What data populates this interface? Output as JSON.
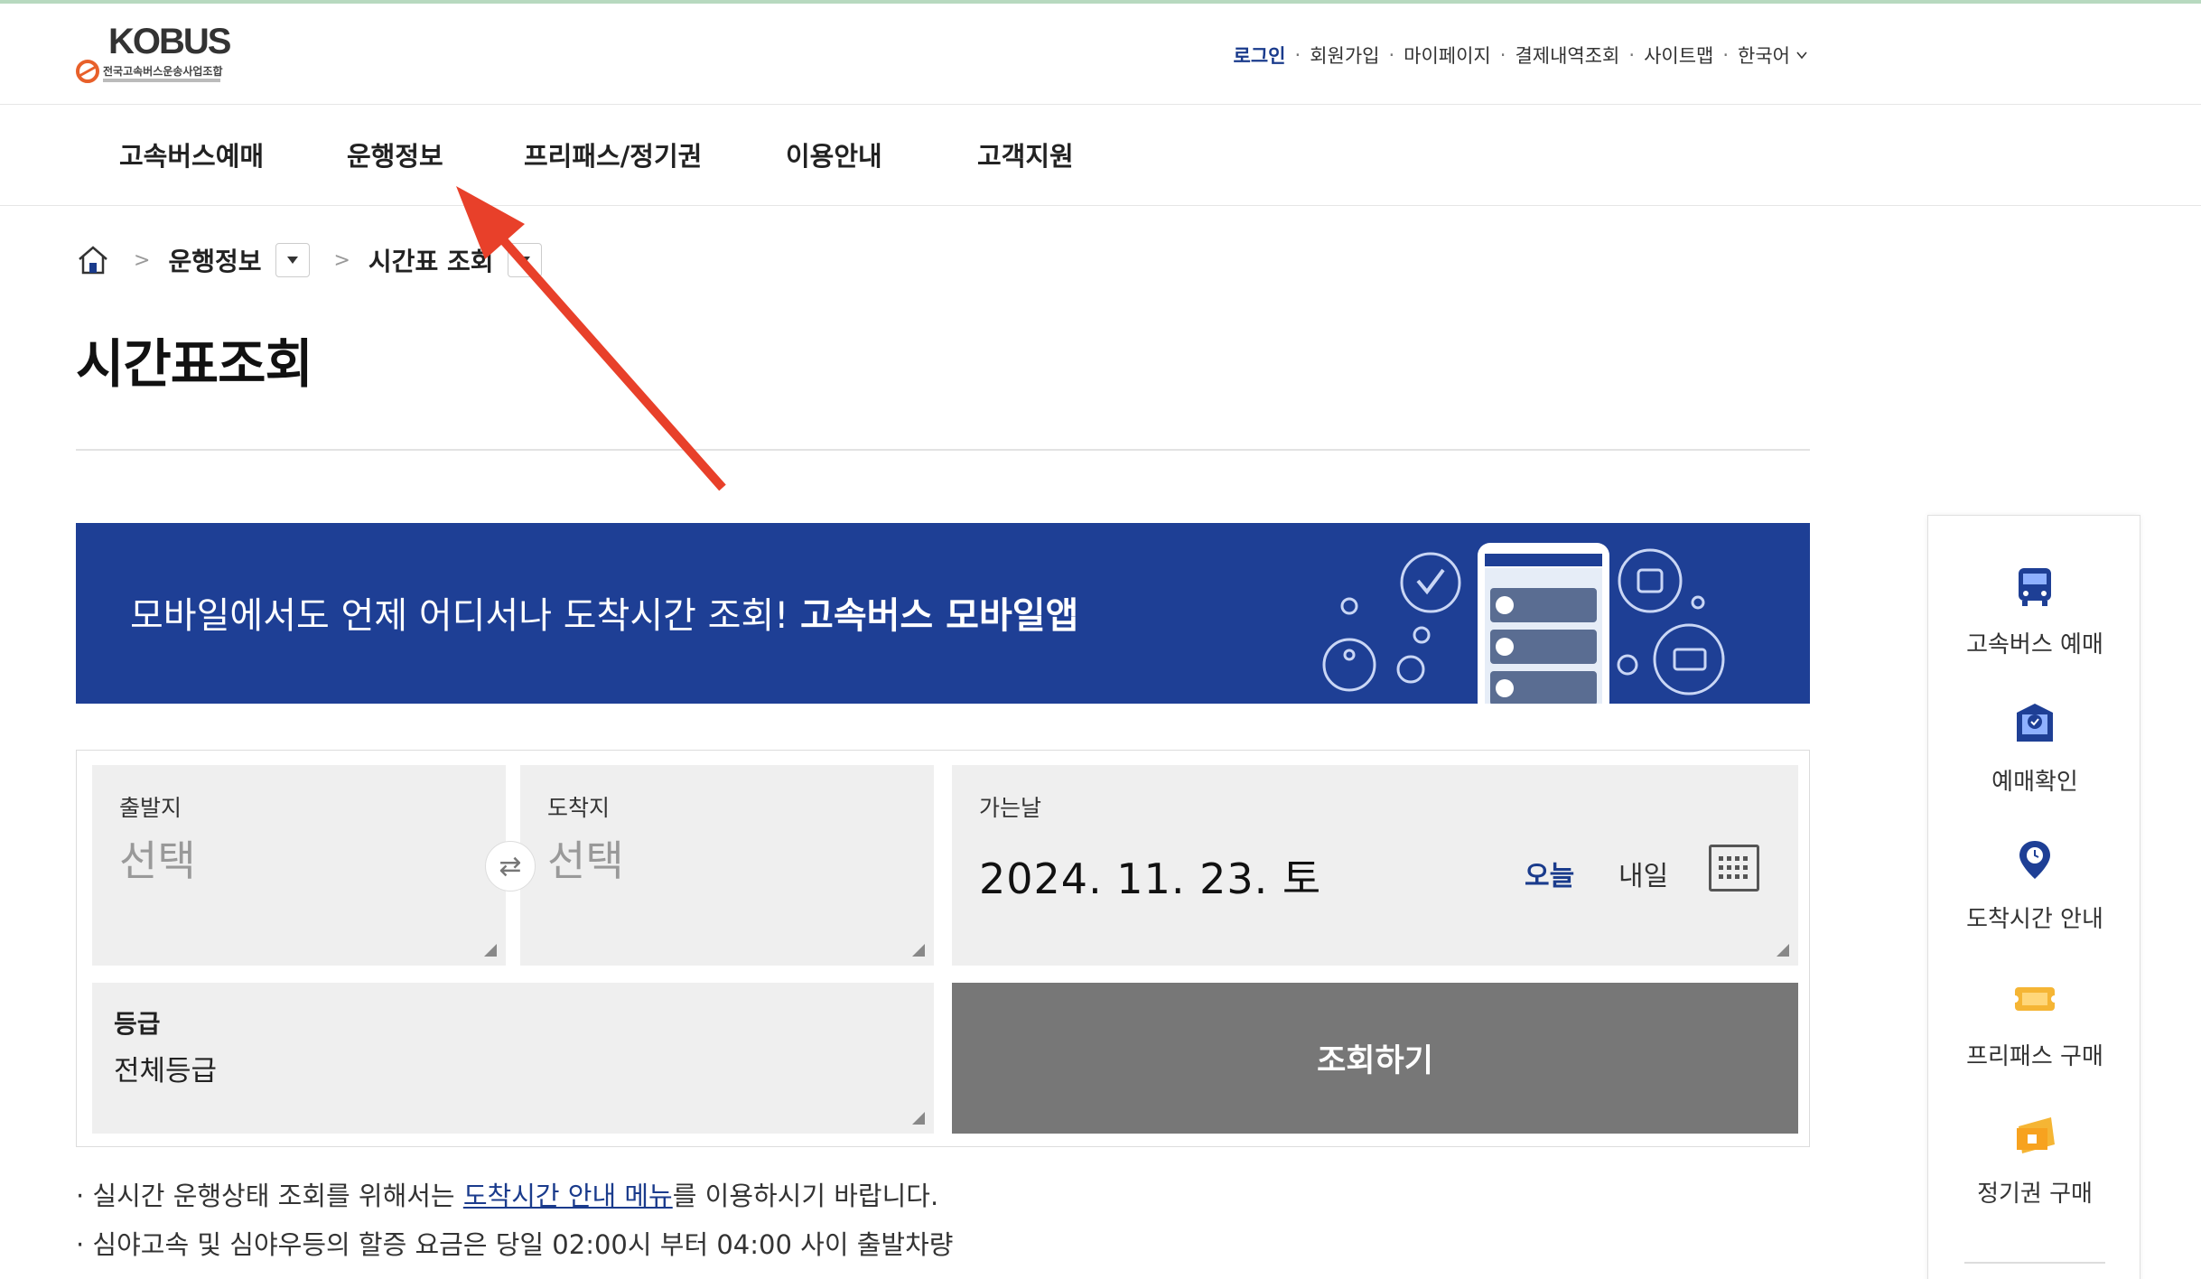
{
  "header": {
    "logo_word": "KOBUS",
    "logo_sub": "전국고속버스운송사업조합",
    "util_links": [
      "로그인",
      "회원가입",
      "마이페이지",
      "결제내역조회",
      "사이트맵",
      "한국어"
    ]
  },
  "gnb": {
    "items": [
      "고속버스예매",
      "운행정보",
      "프리패스/정기권",
      "이용안내",
      "고객지원"
    ]
  },
  "breadcrumb": {
    "level1": "운행정보",
    "level2": "시간표 조회"
  },
  "page": {
    "title": "시간표조회"
  },
  "banner": {
    "text": "모바일에서도 언제 어디서나 도착시간 조회!",
    "text_bold": "고속버스 모바일앱",
    "bg_color": "#1e3f95"
  },
  "form": {
    "departure": {
      "label": "출발지",
      "value": "선택"
    },
    "arrival": {
      "label": "도착지",
      "value": "선택"
    },
    "date": {
      "label": "가는날",
      "value": "2024. 11. 23. 토",
      "today": "오늘",
      "tomorrow": "내일"
    },
    "grade": {
      "label": "등급",
      "value": "전체등급"
    },
    "search_button": "조회하기"
  },
  "notes": {
    "line1_pre": "· 실시간 운행상태 조회를 위해서는 ",
    "line1_link": "도착시간 안내 메뉴",
    "line1_post": "를 이용하시기 바랍니다.",
    "line2": "· 심야고속 및 심야우등의 할증 요금은 당일 02:00시 부터 04:00 사이 출발차량"
  },
  "quick_menu": {
    "items": [
      {
        "label": "고속버스 예매",
        "icon": "bus-icon"
      },
      {
        "label": "예매확인",
        "icon": "ticket-check-icon"
      },
      {
        "label": "도착시간 안내",
        "icon": "location-pin-icon"
      },
      {
        "label": "프리패스 구매",
        "icon": "free-pass-icon"
      },
      {
        "label": "정기권 구매",
        "icon": "season-ticket-icon"
      }
    ]
  },
  "colors": {
    "accent": "#1a3b8c",
    "annotation_arrow": "#e8402a",
    "button_gray": "#777777"
  }
}
